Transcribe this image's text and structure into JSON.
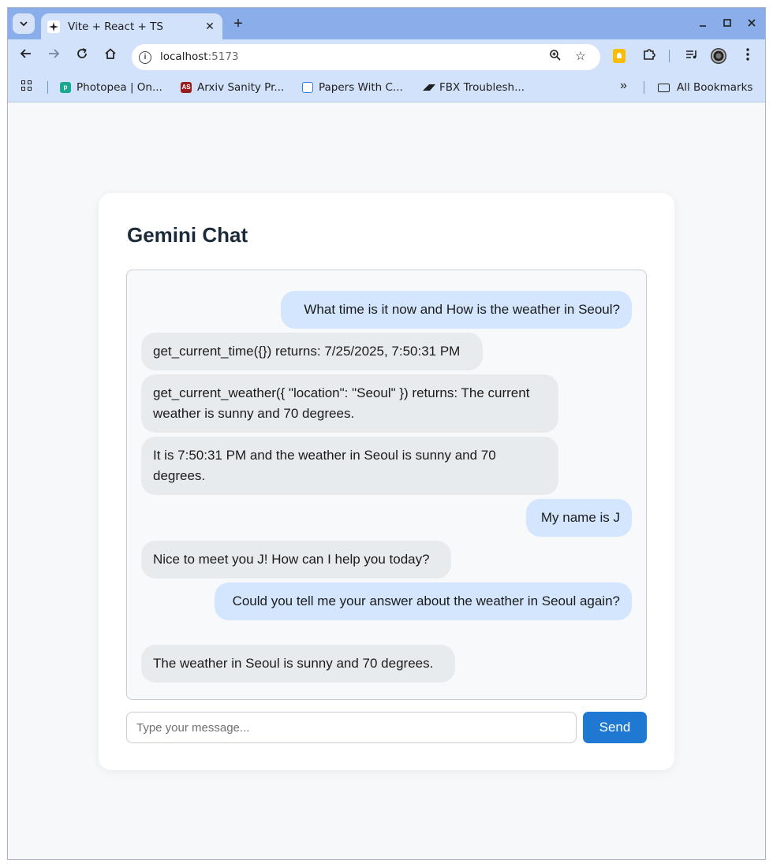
{
  "browser": {
    "tab_title": "Vite + React + TS",
    "tab_favicon": "sparkle-icon",
    "url_host": "localhost",
    "url_port": ":5173",
    "bookmarks": [
      {
        "label": "Photopea | On...",
        "color": "#1aa88e"
      },
      {
        "label": "Arxiv Sanity Pr...",
        "color": "#9b1c1c",
        "badge": "AS"
      },
      {
        "label": "Papers With C...",
        "color": "#2f7fe0"
      },
      {
        "label": "FBX Troublesh...",
        "color": "#1f1f1f"
      }
    ],
    "all_bookmarks_label": "All Bookmarks"
  },
  "page": {
    "title": "Gemini Chat",
    "messages": [
      {
        "role": "user",
        "text": "What time is it now and How is the weather in Seoul?"
      },
      {
        "role": "bot",
        "text": "get_current_time({}) returns: 7/25/2025, 7:50:31 PM"
      },
      {
        "role": "bot",
        "text": "get_current_weather({ \"location\": \"Seoul\" }) returns: The current weather is sunny and 70 degrees."
      },
      {
        "role": "bot",
        "text": "It is 7:50:31 PM and the weather in Seoul is sunny and 70 degrees."
      },
      {
        "role": "user",
        "text": "My name is J"
      },
      {
        "role": "bot",
        "text": "Nice to meet you J! How can I help you today?"
      },
      {
        "role": "user",
        "text": "Could you tell me your answer about the weather in Seoul again?"
      },
      {
        "role": "bot",
        "text": "The weather in Seoul is sunny and 70 degrees."
      }
    ],
    "input_placeholder": "Type your message...",
    "input_value": "",
    "send_label": "Send"
  },
  "colors": {
    "user_bubble": "#d3e6fd",
    "bot_bubble": "#e8ebee",
    "send_button": "#1f78d1",
    "chrome_frame": "#8aaeea",
    "chrome_toolbar": "#d3e2fb"
  }
}
